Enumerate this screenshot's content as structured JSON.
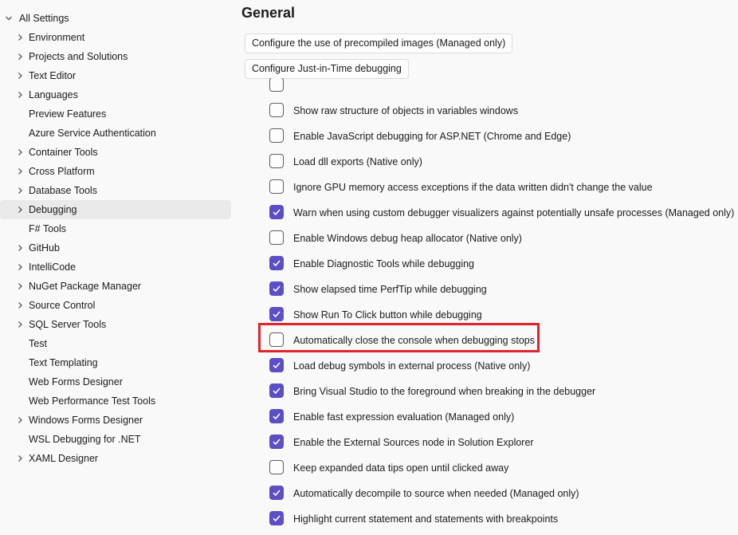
{
  "sidebar": {
    "root": {
      "label": "All Settings",
      "expanded": true
    },
    "items": [
      {
        "label": "Environment",
        "expandable": true
      },
      {
        "label": "Projects and Solutions",
        "expandable": true
      },
      {
        "label": "Text Editor",
        "expandable": true
      },
      {
        "label": "Languages",
        "expandable": true
      },
      {
        "label": "Preview Features",
        "expandable": false
      },
      {
        "label": "Azure Service Authentication",
        "expandable": false
      },
      {
        "label": "Container Tools",
        "expandable": true
      },
      {
        "label": "Cross Platform",
        "expandable": true
      },
      {
        "label": "Database Tools",
        "expandable": true
      },
      {
        "label": "Debugging",
        "expandable": true,
        "selected": true
      },
      {
        "label": "F# Tools",
        "expandable": false
      },
      {
        "label": "GitHub",
        "expandable": true
      },
      {
        "label": "IntelliCode",
        "expandable": true
      },
      {
        "label": "NuGet Package Manager",
        "expandable": true
      },
      {
        "label": "Source Control",
        "expandable": true
      },
      {
        "label": "SQL Server Tools",
        "expandable": true
      },
      {
        "label": "Test",
        "expandable": false
      },
      {
        "label": "Text Templating",
        "expandable": false
      },
      {
        "label": "Web Forms Designer",
        "expandable": false
      },
      {
        "label": "Web Performance Test Tools",
        "expandable": false
      },
      {
        "label": "Windows Forms Designer",
        "expandable": true
      },
      {
        "label": "WSL Debugging for .NET",
        "expandable": false
      },
      {
        "label": "XAML Designer",
        "expandable": true
      }
    ]
  },
  "main": {
    "title": "General",
    "buttons": {
      "precompiled": "Configure the use of precompiled images (Managed only)",
      "jit": "Configure Just-in-Time debugging"
    },
    "options": [
      {
        "label": "",
        "checked": false
      },
      {
        "label": "Show raw structure of objects in variables windows",
        "checked": false
      },
      {
        "label": "Enable JavaScript debugging for ASP.NET (Chrome and Edge)",
        "checked": false
      },
      {
        "label": "Load dll exports (Native only)",
        "checked": false
      },
      {
        "label": "Ignore GPU memory access exceptions if the data written didn't change the value",
        "checked": false
      },
      {
        "label": "Warn when using custom debugger visualizers against potentially unsafe processes (Managed only)",
        "checked": true
      },
      {
        "label": "Enable Windows debug heap allocator (Native only)",
        "checked": false
      },
      {
        "label": "Enable Diagnostic Tools while debugging",
        "checked": true
      },
      {
        "label": "Show elapsed time PerfTip while debugging",
        "checked": true
      },
      {
        "label": "Show Run To Click button while debugging",
        "checked": true
      },
      {
        "label": "Automatically close the console when debugging stops",
        "checked": false,
        "highlighted": true
      },
      {
        "label": "Load debug symbols in external process (Native only)",
        "checked": true
      },
      {
        "label": "Bring Visual Studio to the foreground when breaking in the debugger",
        "checked": true
      },
      {
        "label": "Enable fast expression evaluation (Managed only)",
        "checked": true
      },
      {
        "label": "Enable the External Sources node in Solution Explorer",
        "checked": true
      },
      {
        "label": "Keep expanded data tips open until clicked away",
        "checked": false
      },
      {
        "label": "Automatically decompile to source when needed (Managed only)",
        "checked": true
      },
      {
        "label": "Highlight current statement and statements with breakpoints",
        "checked": true
      }
    ]
  },
  "colors": {
    "accent": "#5b4fc4",
    "highlight_border": "#e0242b",
    "selected_row": "#eaeaea"
  },
  "icons": {
    "expanded": "chevron-down-icon",
    "collapsed": "chevron-right-icon",
    "check": "checkmark-icon"
  }
}
